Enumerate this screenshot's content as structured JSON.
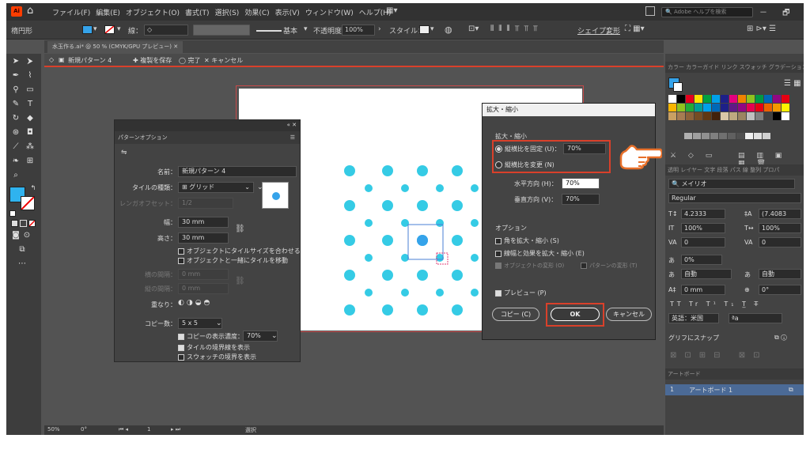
{
  "menubar": {
    "logo": "Ai",
    "items": [
      "ファイル(F)",
      "編集(E)",
      "オブジェクト(O)",
      "書式(T)",
      "選択(S)",
      "効果(C)",
      "表示(V)",
      "ウィンドウ(W)",
      "ヘルプ(H)"
    ],
    "search_placeholder": "Adobe ヘルプを検索",
    "window_controls": "－ 🗗 ✕"
  },
  "controlbar": {
    "object_type": "楕円形",
    "stroke_label": "線：",
    "brush_label": "基本",
    "opacity_label": "不透明度：",
    "opacity_value": "100%",
    "style_label": "スタイル：",
    "shape_label": "シェイプ：",
    "transform_label": "変形"
  },
  "document_tab": "水玉作る.ai* @ 50 % (CMYK/GPU プレビュー)",
  "pattern_bar": {
    "name": "新規パターン 4",
    "save_copy": "複製を保存",
    "done": "完了",
    "cancel": "キャンセル"
  },
  "statusbar": {
    "zoom": "50%",
    "angle": "0°",
    "page": "1",
    "mode": "選択"
  },
  "pattern_options": {
    "title": "パターンオプション",
    "name_label": "名前：",
    "name_value": "新規パターン 4",
    "tile_type_label": "タイルの種類：",
    "tile_type_value": "グリッド",
    "brick_offset_label": "レンガオフセット：",
    "brick_offset_value": "1/2",
    "width_label": "幅：",
    "width_value": "30 mm",
    "height_label": "高さ：",
    "height_value": "30 mm",
    "size_to_art": "オブジェクトにタイルサイズを合わせる",
    "move_tile_with_art": "オブジェクトと一緒にタイルを移動",
    "h_spacing_label": "横の間隔：",
    "h_spacing_value": "0 mm",
    "v_spacing_label": "縦の間隔：",
    "v_spacing_value": "0 mm",
    "overlap_label": "重なり：",
    "copies_label": "コピー数：",
    "copies_value": "5 x 5",
    "dim_copies": "コピーの表示濃度：",
    "dim_value": "70%",
    "show_tile_edge": "タイルの境界線を表示",
    "show_swatch_bounds": "スウォッチの境界を表示"
  },
  "scale_dialog": {
    "title": "拡大・縮小",
    "section_scale": "拡大・縮小",
    "uniform_label": "縦横比を固定 (U)：",
    "uniform_value": "70%",
    "nonuniform_label": "縦横比を変更 (N)",
    "horizontal_label": "水平方向 (H)：",
    "horizontal_value": "70%",
    "vertical_label": "垂直方向 (V)：",
    "vertical_value": "70%",
    "section_options": "オプション",
    "scale_corners": "角を拡大・縮小 (S)",
    "scale_strokes": "線幅と効果を拡大・縮小 (E)",
    "transform_objects": "オブジェクトの変形 (O)",
    "transform_patterns": "パターンの変形 (T)",
    "preview": "プレビュー (P)",
    "copy_button": "コピー (C)",
    "ok_button": "OK",
    "cancel_button": "キャンセル"
  },
  "right_panel": {
    "tabs_top": "カラー  カラーガイド  リンク  スウォッチ  グラデーション",
    "tabs_char": "透明  レイヤー  文字  段落  パス  線  整列  プロパ",
    "font_family": "メイリオ",
    "font_style": "Regular",
    "font_size": "4.2333",
    "leading": "(7.4083",
    "vscale": "100%",
    "hscale": "100%",
    "kerning": "0",
    "tracking": "0",
    "tsume": "0%",
    "aki_left": "自動",
    "aki_right": "自動",
    "baseline": "0 mm",
    "rotation": "0°",
    "language": "英語：米国",
    "snap_glyph": "グリフにスナップ",
    "artboard_tab": "アートボード",
    "artboard_row_num": "1",
    "artboard_row_name": "アートボード 1"
  },
  "colors": {
    "accent": "#35cbe5",
    "highlight_red": "#d9402a"
  }
}
